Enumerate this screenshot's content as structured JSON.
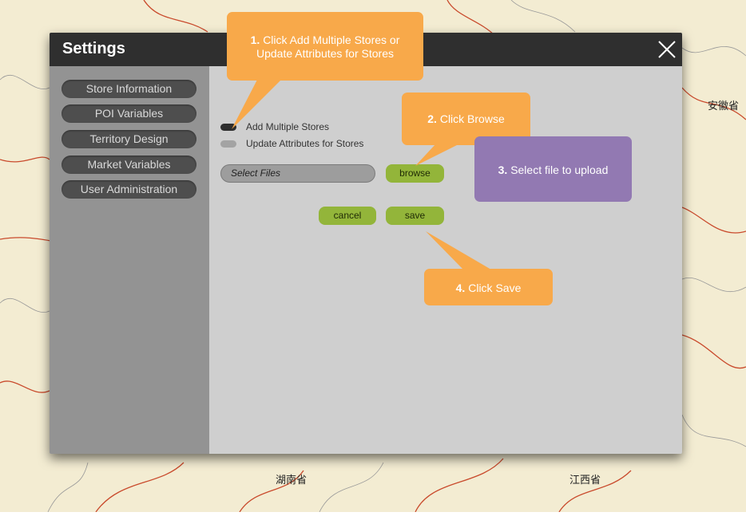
{
  "map": {
    "labels": [
      "安徽省",
      "湖南省",
      "江西省"
    ]
  },
  "dialog": {
    "title": "Settings",
    "close_icon": "close-icon",
    "sidebar": {
      "items": [
        {
          "label": "Store Information"
        },
        {
          "label": "POI Variables"
        },
        {
          "label": "Territory Design"
        },
        {
          "label": "Market Variables"
        },
        {
          "label": "User Administration"
        }
      ]
    },
    "options": [
      {
        "label": "Add Multiple Stores",
        "selected": true
      },
      {
        "label": "Update Attributes for Stores",
        "selected": false
      }
    ],
    "file_field": {
      "placeholder": "Select Files"
    },
    "browse_label": "browse",
    "cancel_label": "cancel",
    "save_label": "save"
  },
  "callouts": [
    {
      "step": "1.",
      "text": "Click Add Multiple Stores or Update Attributes for Stores",
      "color": "#f8a94a"
    },
    {
      "step": "2.",
      "text": "Click Browse",
      "color": "#f8a94a"
    },
    {
      "step": "3.",
      "text": "Select file to upload",
      "color": "#9279b2"
    },
    {
      "step": "4.",
      "text": "Click Save",
      "color": "#f8a94a"
    }
  ],
  "colors": {
    "titlebar": "#2f2f2f",
    "sidebar": "#939393",
    "panel": "#cfcfcf",
    "button_green": "#93b53a",
    "map_bg": "#f3ecd2"
  }
}
